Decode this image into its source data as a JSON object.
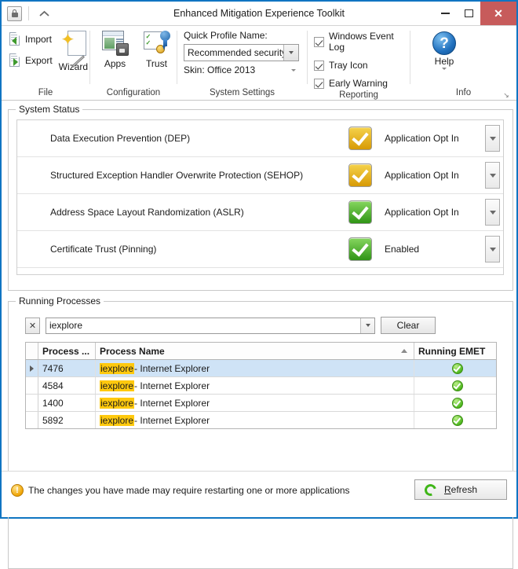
{
  "window": {
    "title": "Enhanced Mitigation Experience Toolkit",
    "app_icon": "lock-icon",
    "quick_access_chevron": "chevron-up-icon",
    "minimize": "–",
    "maximize": "□",
    "close": "✕",
    "close_color": "#c75b5b",
    "border_color": "#1075c2"
  },
  "ribbon": {
    "file": {
      "label": "File",
      "import": "Import",
      "export": "Export",
      "wizard": "Wizard"
    },
    "configuration": {
      "label": "Configuration",
      "apps": "Apps",
      "trust": "Trust"
    },
    "system_settings": {
      "label": "System Settings",
      "quick_profile_label": "Quick Profile Name:",
      "quick_profile_value": "Recommended security ...",
      "skin": "Skin: Office 2013"
    },
    "reporting": {
      "label": "Reporting",
      "checkboxes": [
        {
          "label": "Windows Event Log",
          "checked": true
        },
        {
          "label": "Tray Icon",
          "checked": true
        },
        {
          "label": "Early Warning",
          "checked": true
        }
      ]
    },
    "info": {
      "label": "Info",
      "help": "Help",
      "dialog_launcher": "↘"
    }
  },
  "system_status": {
    "title": "System Status",
    "rows": [
      {
        "name": "Data Execution Prevention (DEP)",
        "value": "Application Opt In",
        "state": "gold"
      },
      {
        "name": "Structured Exception Handler Overwrite Protection (SEHOP)",
        "value": "Application Opt In",
        "state": "gold"
      },
      {
        "name": "Address Space Layout Randomization (ASLR)",
        "value": "Application Opt In",
        "state": "green"
      },
      {
        "name": "Certificate Trust (Pinning)",
        "value": "Enabled",
        "state": "green"
      }
    ],
    "gold_color": "#d79a05",
    "green_color": "#2f9415"
  },
  "running_processes": {
    "title": "Running Processes",
    "filter_clear_icon": "✕",
    "filter_value": "iexplore",
    "clear_button": "Clear",
    "columns": [
      "Process ...",
      "Process Name",
      "Running EMET"
    ],
    "sort_column": "Process Name",
    "sort_direction": "ascending",
    "highlight_term": "iexplore",
    "highlight_color": "#ffc90e",
    "selection_color": "#cfe3f6",
    "rows": [
      {
        "pid": "7476",
        "name_hl": "iexplore",
        "name_rest": " - Internet Explorer",
        "emet": "check-ok-icon",
        "selected": true
      },
      {
        "pid": "4584",
        "name_hl": "iexplore",
        "name_rest": " - Internet Explorer",
        "emet": "check-ok-icon",
        "selected": false
      },
      {
        "pid": "1400",
        "name_hl": "iexplore",
        "name_rest": " - Internet Explorer",
        "emet": "check-ok-icon",
        "selected": false
      },
      {
        "pid": "5892",
        "name_hl": "iexplore",
        "name_rest": " - Internet Explorer",
        "emet": "check-ok-icon",
        "selected": false
      }
    ]
  },
  "statusbar": {
    "warning_icon": "!",
    "message": "The changes you have made may require restarting one or more applications",
    "refresh_label_u": "R",
    "refresh_label_rest": "efresh"
  }
}
